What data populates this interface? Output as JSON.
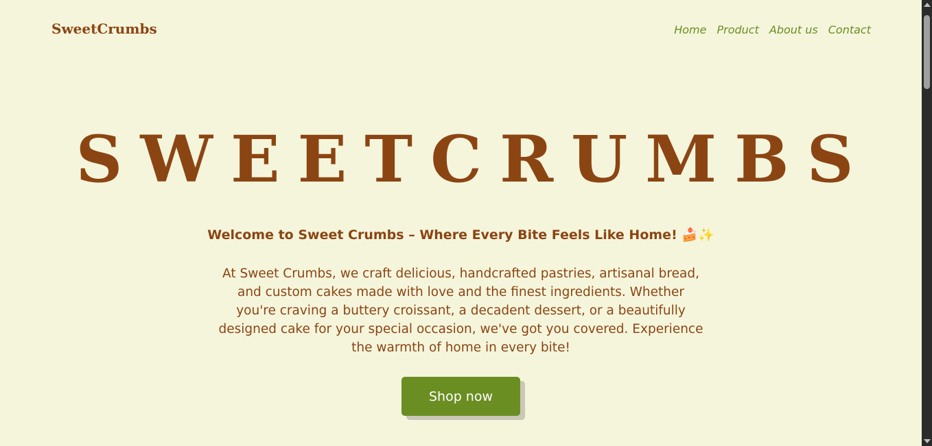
{
  "header": {
    "logo": "SweetCrumbs",
    "nav": [
      {
        "label": "Home"
      },
      {
        "label": "Product"
      },
      {
        "label": "About us"
      },
      {
        "label": "Contact"
      }
    ]
  },
  "hero": {
    "title": "SWEETCRUMBS",
    "welcome": "Welcome to Sweet Crumbs – Where Every Bite Feels Like Home!",
    "welcome_emoji": "🍰✨",
    "description": "At Sweet Crumbs, we craft delicious, handcrafted pastries, artisanal bread, and custom cakes made with love and the finest ingredients. Whether you're craving a buttery croissant, a decadent dessert, or a beautifully designed cake for your special occasion, we've got you covered. Experience the warmth of home in every bite!",
    "cta_label": "Shop now"
  },
  "colors": {
    "background": "#f5f5dc",
    "brand_brown": "#8b4513",
    "accent_green": "#6b8e23"
  }
}
